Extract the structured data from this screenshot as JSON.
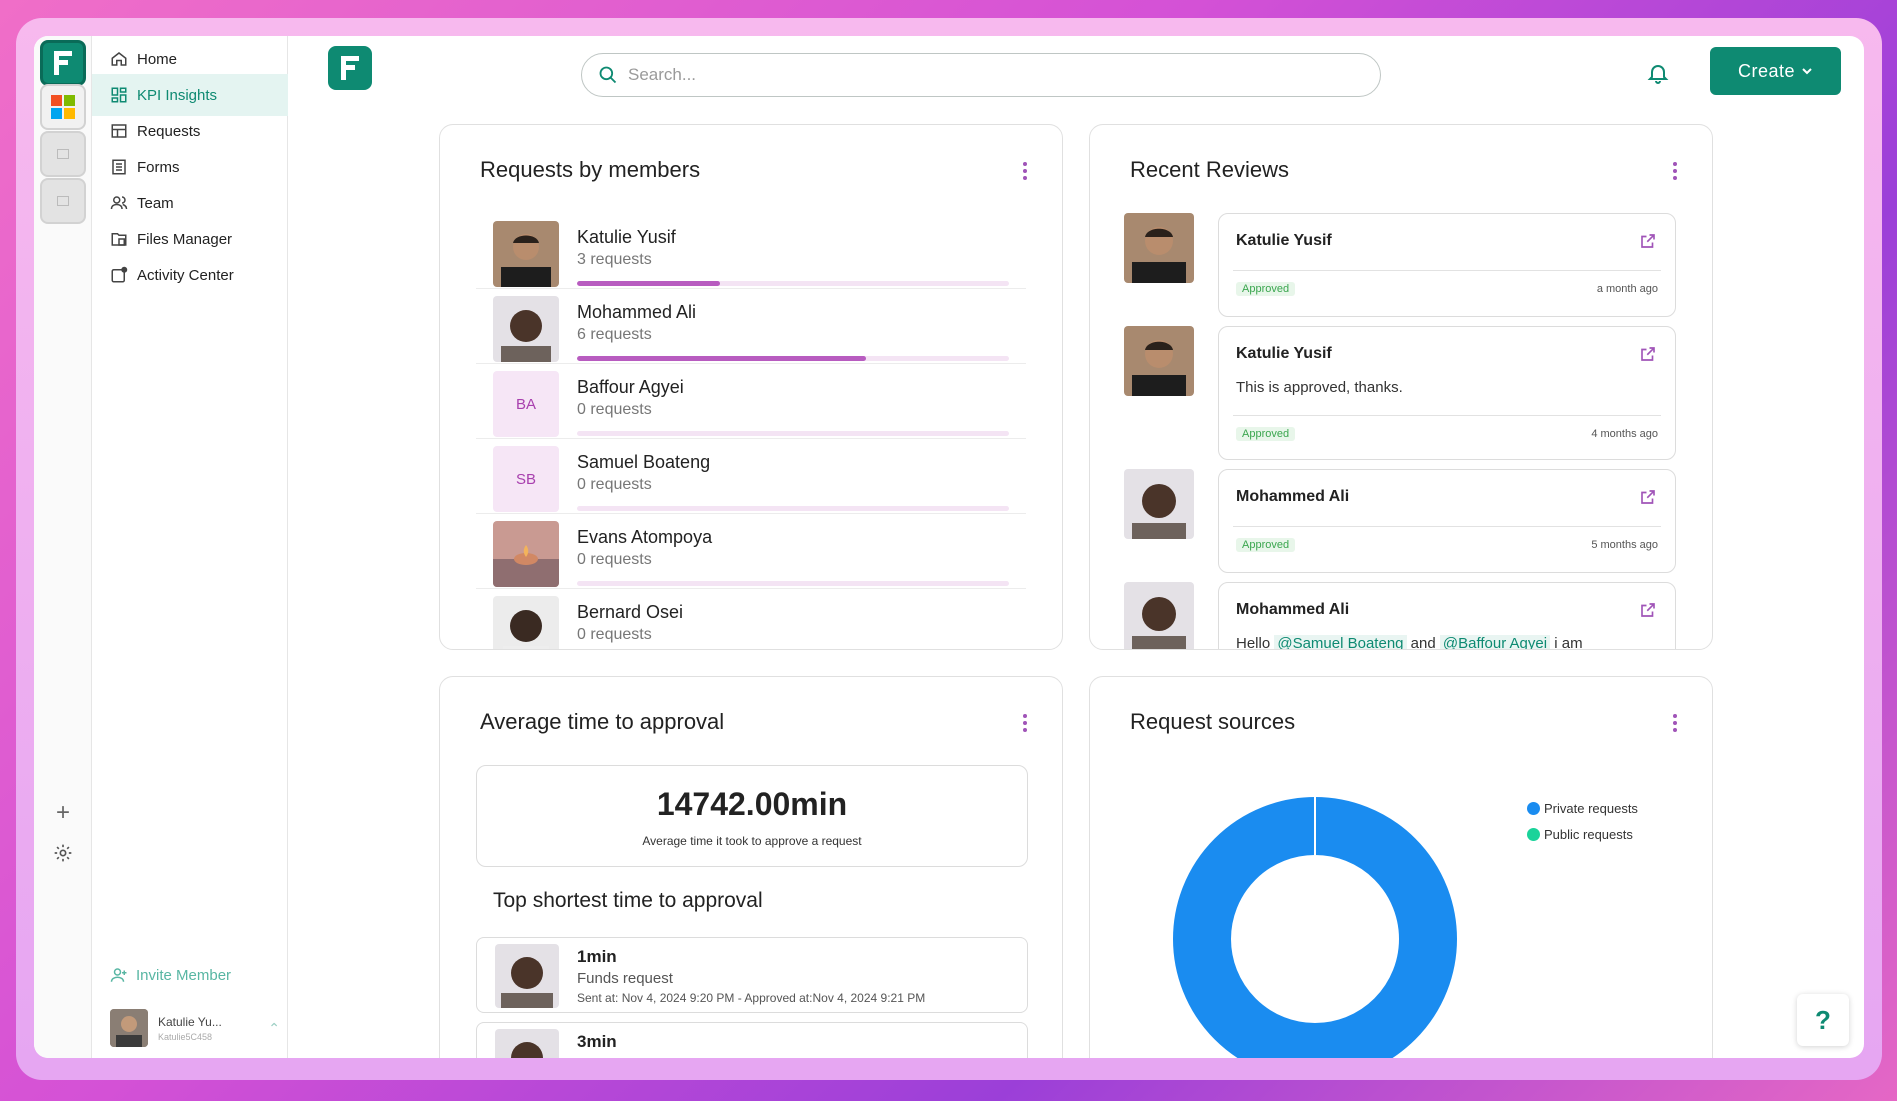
{
  "search": {
    "placeholder": "Search..."
  },
  "header": {
    "create_label": "Create"
  },
  "nav": [
    {
      "label": "Home",
      "icon": "home-icon"
    },
    {
      "label": "KPI Insights",
      "icon": "dashboard-icon",
      "active": true
    },
    {
      "label": "Requests",
      "icon": "requests-icon"
    },
    {
      "label": "Forms",
      "icon": "forms-icon"
    },
    {
      "label": "Team",
      "icon": "team-icon"
    },
    {
      "label": "Files Manager",
      "icon": "files-icon"
    },
    {
      "label": "Activity Center",
      "icon": "activity-icon"
    }
  ],
  "sidebar": {
    "invite_label": "Invite Member",
    "user": {
      "name": "Katulie Yu...",
      "handle": "Katulie5C458"
    }
  },
  "members_card": {
    "title": "Requests by members",
    "members": [
      {
        "name": "Katulie Yusif",
        "requests": "3 requests",
        "share": 0.33,
        "avatar": "photo"
      },
      {
        "name": "Mohammed Ali",
        "requests": "6 requests",
        "share": 0.67,
        "avatar": "photo"
      },
      {
        "name": "Baffour Agyei",
        "requests": "0 requests",
        "share": 0,
        "initials": "BA"
      },
      {
        "name": "Samuel Boateng",
        "requests": "0 requests",
        "share": 0,
        "initials": "SB"
      },
      {
        "name": "Evans Atompoya",
        "requests": "0 requests",
        "share": 0,
        "avatar": "photo"
      },
      {
        "name": "Bernard Osei",
        "requests": "0 requests",
        "share": 0,
        "avatar": "photo"
      }
    ]
  },
  "reviews_card": {
    "title": "Recent Reviews",
    "reviews": [
      {
        "name": "Katulie Yusif",
        "message": "",
        "status": "Approved",
        "time": "a month ago"
      },
      {
        "name": "Katulie Yusif",
        "message": "This is approved, thanks.",
        "status": "Approved",
        "time": "4 months ago"
      },
      {
        "name": "Mohammed Ali",
        "message": "",
        "status": "Approved",
        "time": "5 months ago"
      },
      {
        "name": "Mohammed Ali",
        "message_parts": [
          "Hello ",
          "@Samuel Boateng",
          " and ",
          "@Baffour Agyei",
          " i am"
        ]
      }
    ]
  },
  "approval_card": {
    "title": "Average time to approval",
    "value": "14742.00min",
    "value_caption": "Average time it took to approve a request",
    "subheading": "Top shortest time to approval",
    "items": [
      {
        "time": "1min",
        "type": "Funds request",
        "meta": "Sent at: Nov 4, 2024 9:20 PM - Approved at:Nov 4, 2024 9:21 PM"
      },
      {
        "time": "3min",
        "type": "",
        "meta": ""
      }
    ]
  },
  "sources_card": {
    "title": "Request sources",
    "legend": [
      {
        "label": "Private requests",
        "color": "#1a8cf0"
      },
      {
        "label": "Public requests",
        "color": "#1ad39a"
      }
    ]
  },
  "chart_data": {
    "type": "pie",
    "categories": [
      "Private requests",
      "Public requests"
    ],
    "values": [
      100,
      0
    ],
    "colors": [
      "#1a8cf0",
      "#1ad39a"
    ],
    "title": "Request sources",
    "legend": "right"
  },
  "help": {
    "label": "?"
  },
  "colors": {
    "brand": "#0e8a72",
    "accent": "#a054b8",
    "approved": "#3aa64e"
  }
}
